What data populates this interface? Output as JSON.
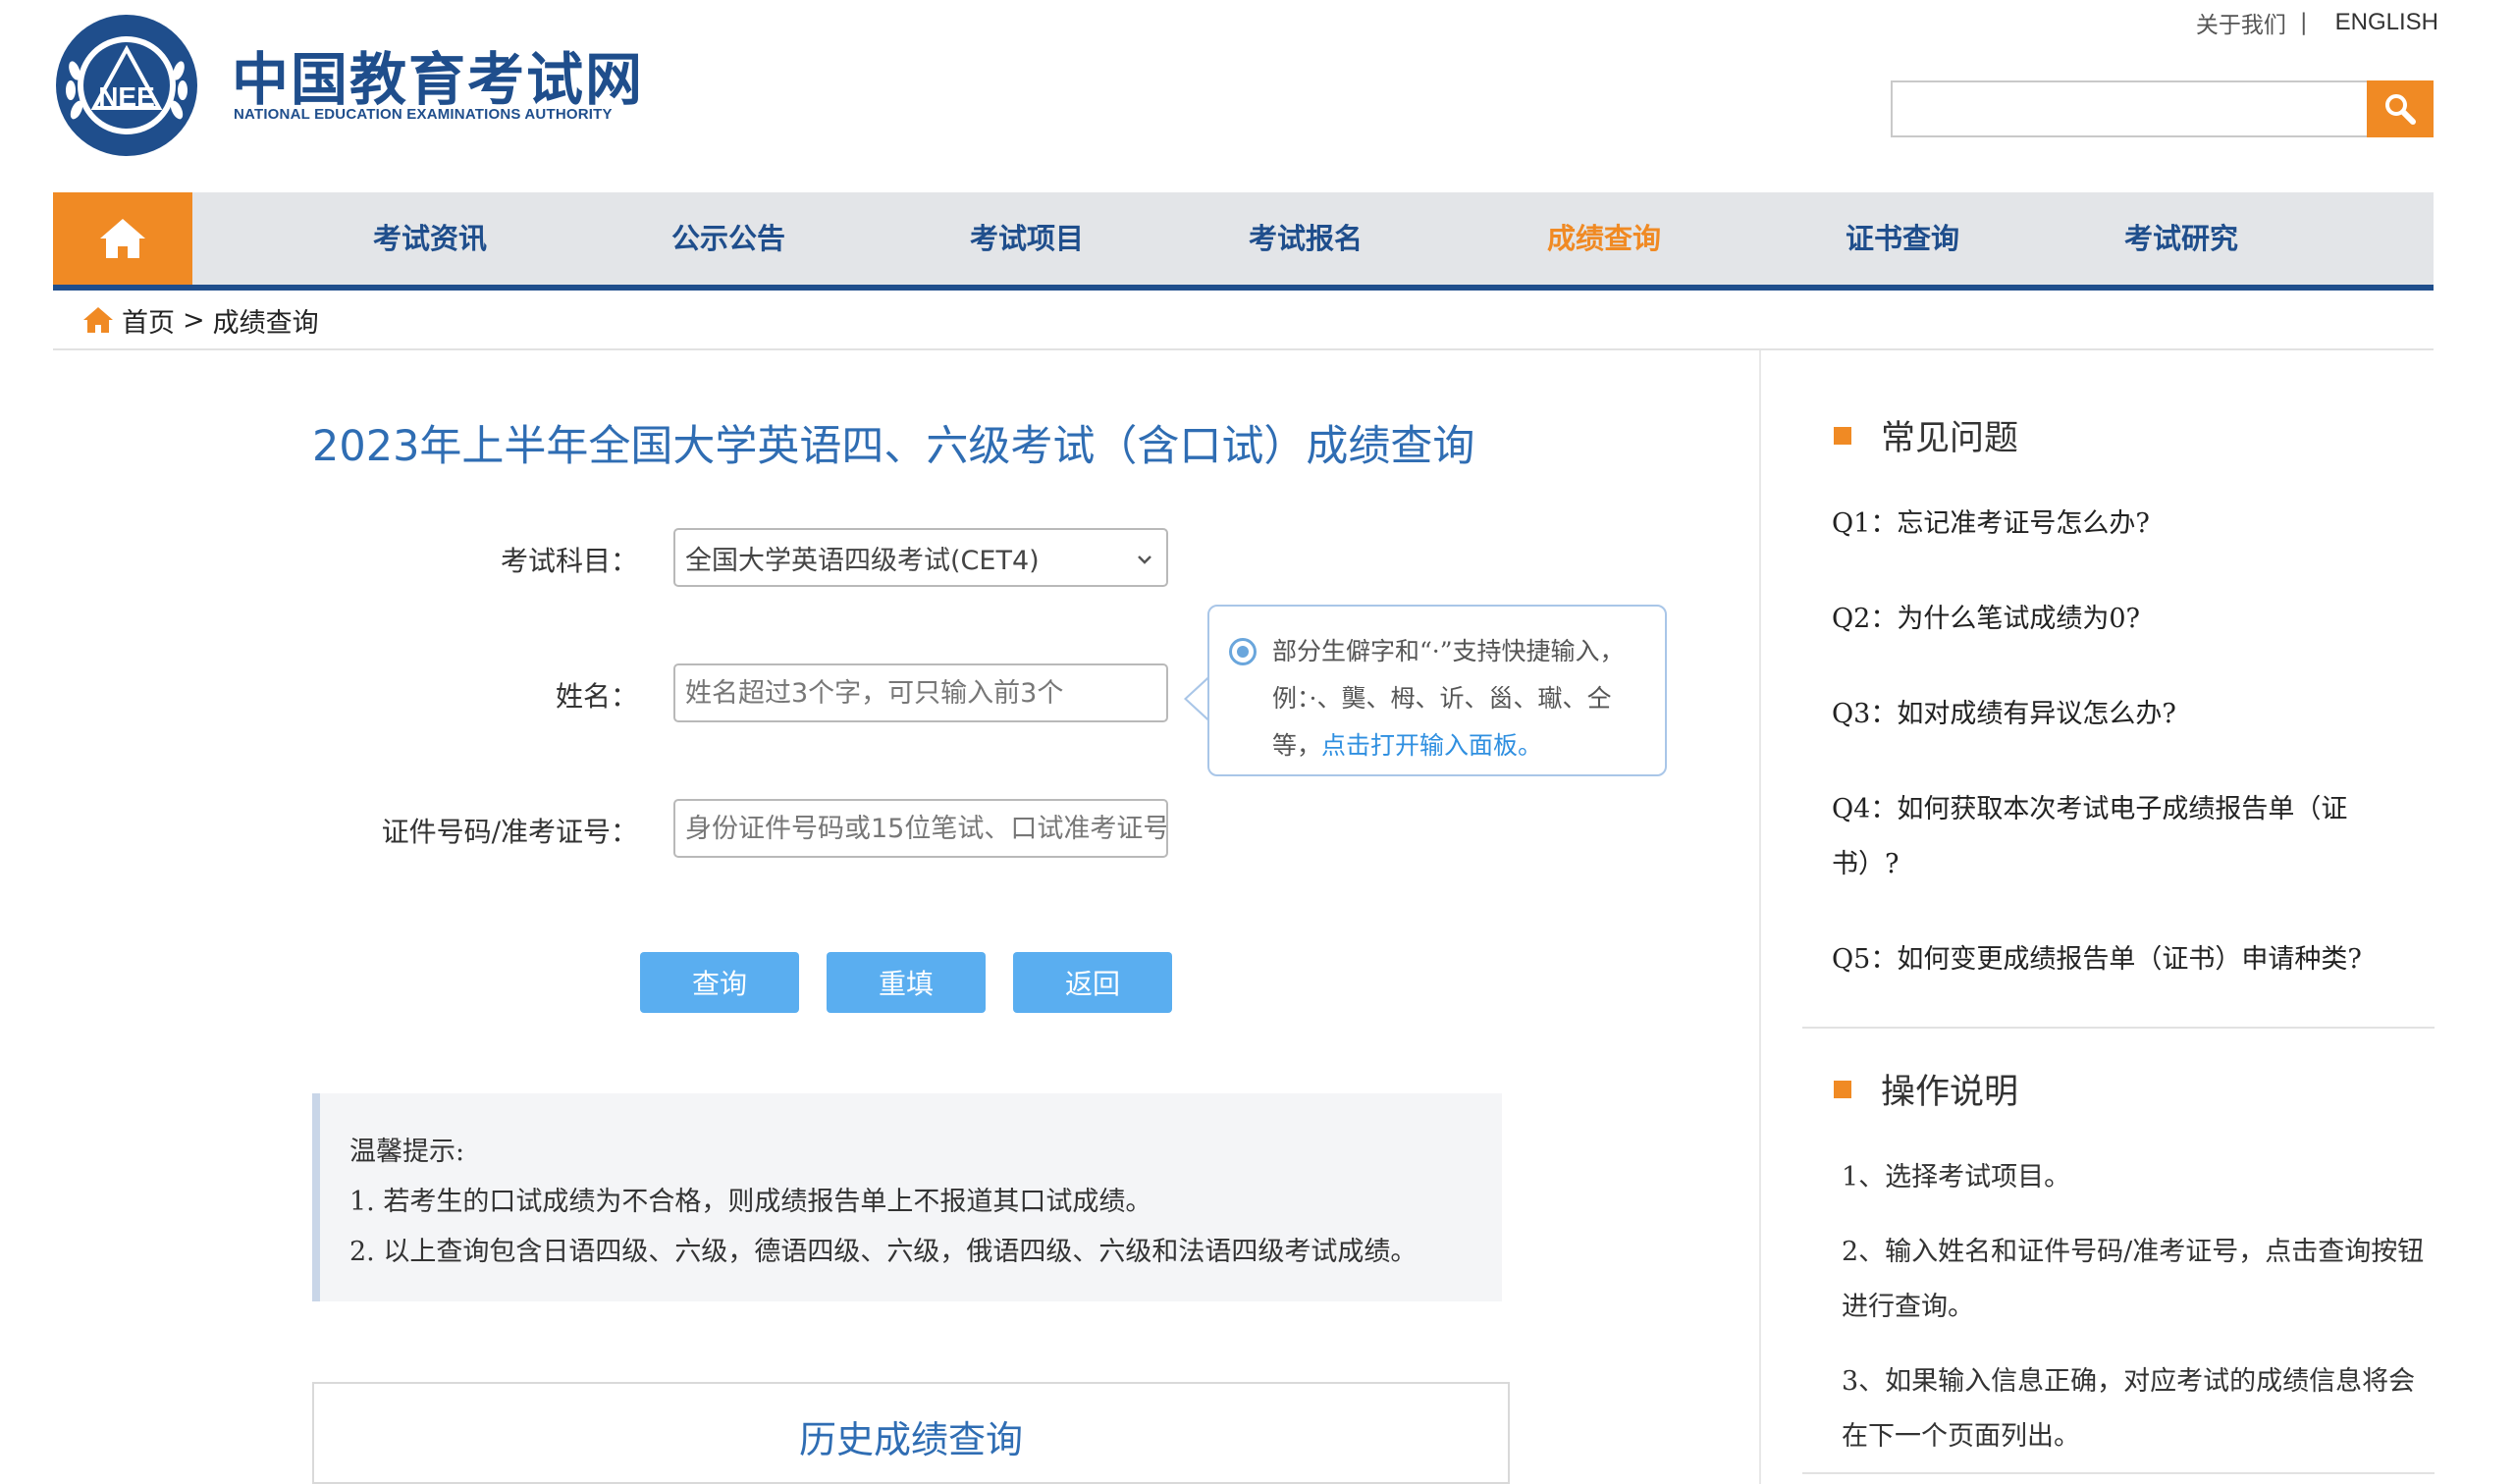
{
  "header": {
    "logo_cn": "中国教育考试网",
    "logo_en": "NATIONAL EDUCATION EXAMINATIONS AUTHORITY",
    "emblem_text": "NEE",
    "about_link": "关于我们",
    "separator": "|",
    "english_link": "ENGLISH",
    "search_placeholder": ""
  },
  "nav": {
    "items": [
      {
        "label": "考试资讯"
      },
      {
        "label": "公示公告"
      },
      {
        "label": "考试项目"
      },
      {
        "label": "考试报名"
      },
      {
        "label": "成绩查询"
      },
      {
        "label": "证书查询"
      },
      {
        "label": "考试研究"
      }
    ],
    "active_index": 4
  },
  "breadcrumb": {
    "home": "首页",
    "separator": ">",
    "current": "成绩查询"
  },
  "main": {
    "title": "2023年上半年全国大学英语四、六级考试（含口试）成绩查询",
    "form": {
      "subject_label": "考试科目：",
      "subject_value": "全国大学英语四级考试(CET4)",
      "name_label": "姓名：",
      "name_placeholder": "姓名超过3个字，可只输入前3个",
      "id_label": "证件号码/准考证号：",
      "id_placeholder": "身份证件号码或15位笔试、口试准考证号"
    },
    "tip": {
      "line1": "部分生僻字和“·”支持快捷输入，",
      "line2": "例：·、龑、栂、䜣、𡿺、𤩽、仝",
      "line3_prefix": "等，",
      "line3_link": "点击打开输入面板。"
    },
    "buttons": {
      "query": "查询",
      "reset": "重填",
      "back": "返回"
    },
    "notice": {
      "heading": "温馨提示:",
      "items": [
        "1. 若考生的口试成绩为不合格，则成绩报告单上不报道其口试成绩。",
        "2. 以上查询包含日语四级、六级，德语四级、六级，俄语四级、六级和法语四级考试成绩。"
      ]
    },
    "history_title": "历史成绩查询"
  },
  "sidebar": {
    "faq_title": "常见问题",
    "faq": [
      "Q1：忘记准考证号怎么办?",
      "Q2：为什么笔试成绩为0?",
      "Q3：如对成绩有异议怎么办?",
      "Q4：如何获取本次考试电子成绩报告单（证书）?",
      "Q5：如何变更成绩报告单（证书）申请种类?"
    ],
    "guide_title": "操作说明",
    "guide": [
      "1、选择考试项目。",
      "2、输入姓名和证件号码/准考证号，点击查询按钮进行查询。",
      "3、如果输入信息正确，对应考试的成绩信息将会在下一个页面列出。"
    ]
  },
  "colors": {
    "brand_blue": "#1f4e8c",
    "accent_orange": "#f08a24",
    "link_blue": "#2f6db3",
    "button_blue": "#5aaef0"
  },
  "icons": {
    "search": "magnifier-icon",
    "home": "house-icon",
    "select": "chevron-down-icon",
    "tip": "radio-icon"
  }
}
